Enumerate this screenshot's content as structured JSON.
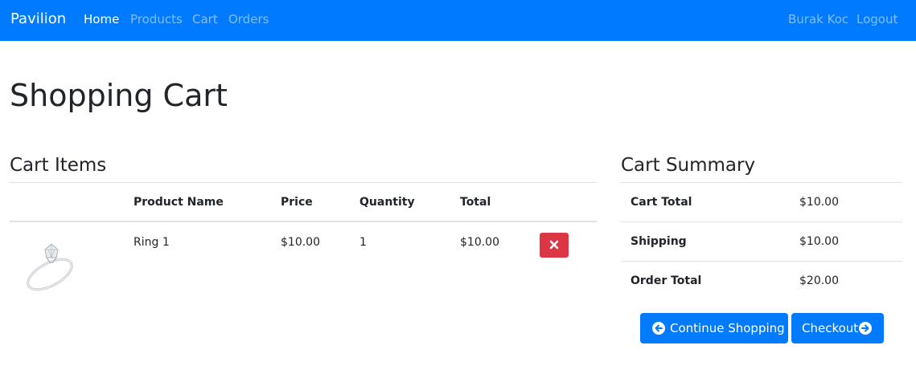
{
  "navbar": {
    "brand": "Pavilion",
    "links": [
      "Home",
      "Products",
      "Cart",
      "Orders"
    ],
    "user": "Burak Koc",
    "logout": "Logout"
  },
  "page": {
    "title": "Shopping Cart"
  },
  "cart": {
    "title": "Cart Items",
    "headers": [
      "Product Name",
      "Price",
      "Quantity",
      "Total"
    ],
    "items": [
      {
        "name": "Ring 1",
        "price": "$10.00",
        "quantity": "1",
        "total": "$10.00",
        "image_icon": "ring-image",
        "remove_icon": "close-icon"
      }
    ]
  },
  "summary": {
    "title": "Cart Summary",
    "rows": [
      {
        "label": "Cart Total",
        "value": "$10.00"
      },
      {
        "label": "Shipping",
        "value": "$10.00"
      },
      {
        "label": "Order Total",
        "value": "$20.00"
      }
    ],
    "continue_label": "Continue Shopping",
    "checkout_label": "Checkout"
  },
  "colors": {
    "primary": "#007bff",
    "danger": "#dc3545",
    "text": "#212529",
    "border": "#dee2e6"
  },
  "icons": {
    "continue": "arrow-circle-left-icon",
    "checkout": "arrow-circle-right-icon"
  }
}
